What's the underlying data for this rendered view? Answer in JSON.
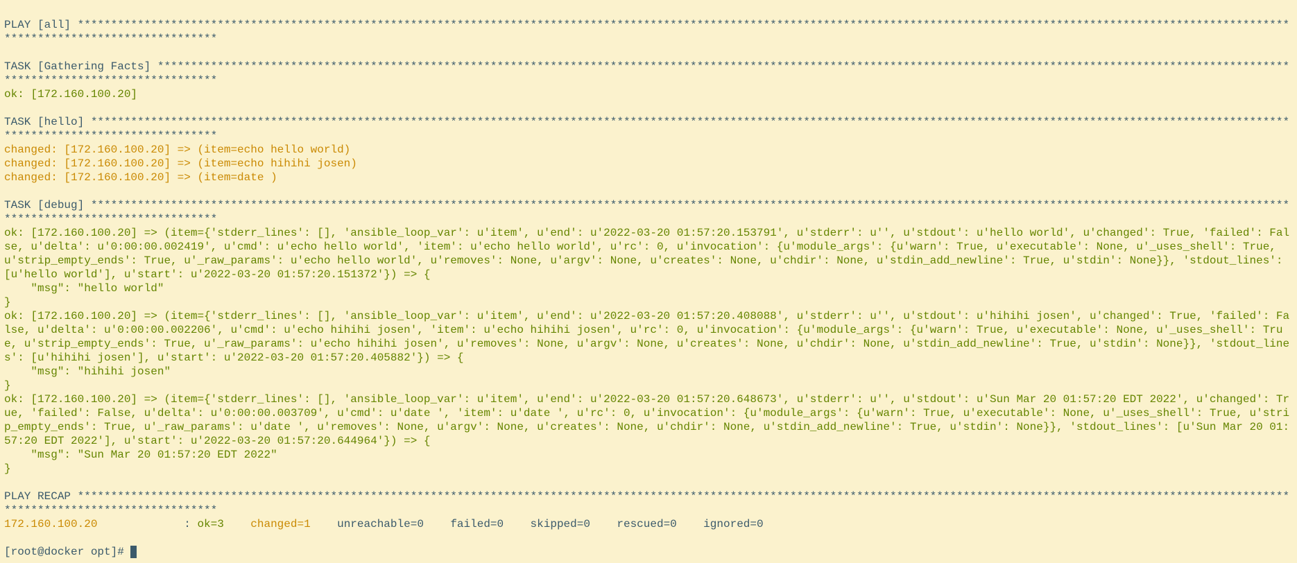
{
  "lines": [
    {
      "segs": [
        {
          "t": "",
          "c": "teal"
        }
      ]
    },
    {
      "segs": [
        {
          "t": "PLAY [all] **********************************************************************************************************************************************************************************************************************",
          "c": "teal"
        }
      ]
    },
    {
      "segs": [
        {
          "t": "",
          "c": "teal"
        }
      ]
    },
    {
      "segs": [
        {
          "t": "TASK [Gathering Facts] **********************************************************************************************************************************************************************************************************",
          "c": "teal"
        }
      ]
    },
    {
      "segs": [
        {
          "t": "ok: [172.160.100.20]",
          "c": "green"
        }
      ]
    },
    {
      "segs": [
        {
          "t": "",
          "c": "teal"
        }
      ]
    },
    {
      "segs": [
        {
          "t": "TASK [hello] ********************************************************************************************************************************************************************************************************************",
          "c": "teal"
        }
      ]
    },
    {
      "segs": [
        {
          "t": "changed: [172.160.100.20] => (item=echo hello world)",
          "c": "orange"
        }
      ]
    },
    {
      "segs": [
        {
          "t": "changed: [172.160.100.20] => (item=echo hihihi josen)",
          "c": "orange"
        }
      ]
    },
    {
      "segs": [
        {
          "t": "changed: [172.160.100.20] => (item=date )",
          "c": "orange"
        }
      ]
    },
    {
      "segs": [
        {
          "t": "",
          "c": "teal"
        }
      ]
    },
    {
      "segs": [
        {
          "t": "TASK [debug] ********************************************************************************************************************************************************************************************************************",
          "c": "teal"
        }
      ]
    },
    {
      "segs": [
        {
          "t": "ok: [172.160.100.20] => (item={'stderr_lines': [], 'ansible_loop_var': u'item', u'end': u'2022-03-20 01:57:20.153791', u'stderr': u'', u'stdout': u'hello world', u'changed': True, 'failed': False, u'delta': u'0:00:00.002419', u'cmd': u'echo hello world', 'item': u'echo hello world', u'rc': 0, u'invocation': {u'module_args': {u'warn': True, u'executable': None, u'_uses_shell': True, u'strip_empty_ends': True, u'_raw_params': u'echo hello world', u'removes': None, u'argv': None, u'creates': None, u'chdir': None, u'stdin_add_newline': True, u'stdin': None}}, 'stdout_lines': [u'hello world'], u'start': u'2022-03-20 01:57:20.151372'}) => {",
          "c": "green"
        }
      ]
    },
    {
      "segs": [
        {
          "t": "    \"msg\": \"hello world\"",
          "c": "green"
        }
      ]
    },
    {
      "segs": [
        {
          "t": "}",
          "c": "green"
        }
      ]
    },
    {
      "segs": [
        {
          "t": "ok: [172.160.100.20] => (item={'stderr_lines': [], 'ansible_loop_var': u'item', u'end': u'2022-03-20 01:57:20.408088', u'stderr': u'', u'stdout': u'hihihi josen', u'changed': True, 'failed': False, u'delta': u'0:00:00.002206', u'cmd': u'echo hihihi josen', 'item': u'echo hihihi josen', u'rc': 0, u'invocation': {u'module_args': {u'warn': True, u'executable': None, u'_uses_shell': True, u'strip_empty_ends': True, u'_raw_params': u'echo hihihi josen', u'removes': None, u'argv': None, u'creates': None, u'chdir': None, u'stdin_add_newline': True, u'stdin': None}}, 'stdout_lines': [u'hihihi josen'], u'start': u'2022-03-20 01:57:20.405882'}) => {",
          "c": "green"
        }
      ]
    },
    {
      "segs": [
        {
          "t": "    \"msg\": \"hihihi josen\"",
          "c": "green"
        }
      ]
    },
    {
      "segs": [
        {
          "t": "}",
          "c": "green"
        }
      ]
    },
    {
      "segs": [
        {
          "t": "ok: [172.160.100.20] => (item={'stderr_lines': [], 'ansible_loop_var': u'item', u'end': u'2022-03-20 01:57:20.648673', u'stderr': u'', u'stdout': u'Sun Mar 20 01:57:20 EDT 2022', u'changed': True, 'failed': False, u'delta': u'0:00:00.003709', u'cmd': u'date ', 'item': u'date ', u'rc': 0, u'invocation': {u'module_args': {u'warn': True, u'executable': None, u'_uses_shell': True, u'strip_empty_ends': True, u'_raw_params': u'date ', u'removes': None, u'argv': None, u'creates': None, u'chdir': None, u'stdin_add_newline': True, u'stdin': None}}, 'stdout_lines': [u'Sun Mar 20 01:57:20 EDT 2022'], u'start': u'2022-03-20 01:57:20.644964'}) => {",
          "c": "green"
        }
      ]
    },
    {
      "segs": [
        {
          "t": "    \"msg\": \"Sun Mar 20 01:57:20 EDT 2022\"",
          "c": "green"
        }
      ]
    },
    {
      "segs": [
        {
          "t": "}",
          "c": "green"
        }
      ]
    },
    {
      "segs": [
        {
          "t": "",
          "c": "teal"
        }
      ]
    },
    {
      "segs": [
        {
          "t": "PLAY RECAP **********************************************************************************************************************************************************************************************************************",
          "c": "teal"
        }
      ]
    },
    {
      "segs": [
        {
          "t": "172.160.100.20",
          "c": "orange"
        },
        {
          "t": "             : ",
          "c": "teal"
        },
        {
          "t": "ok=3",
          "c": "green"
        },
        {
          "t": "    ",
          "c": "teal"
        },
        {
          "t": "changed=1",
          "c": "orange"
        },
        {
          "t": "    unreachable=0    failed=0    skipped=0    rescued=0    ignored=0",
          "c": "teal"
        }
      ]
    },
    {
      "segs": [
        {
          "t": "",
          "c": "teal"
        }
      ]
    },
    {
      "segs": [
        {
          "t": "[root@docker opt]# ",
          "c": "teal",
          "cursor": true
        }
      ]
    }
  ]
}
